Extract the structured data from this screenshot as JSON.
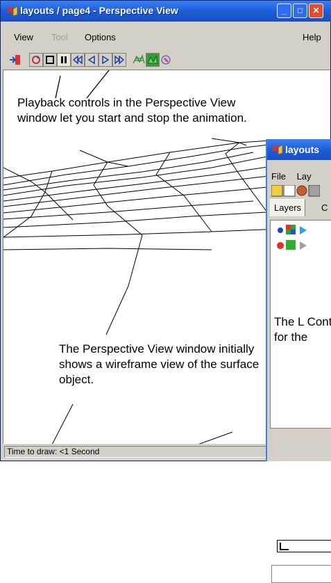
{
  "main_window": {
    "title": "layouts / page4 - Perspective View",
    "menu": {
      "view": "View",
      "tool": "Tool",
      "options": "Options",
      "help": "Help"
    },
    "status_text": "Time to draw: <1 Second"
  },
  "annotations": {
    "playback": "Playback controls in the Perspective View window let you start and stop the animation.",
    "wireframe": "The Perspective View window initially shows a wireframe view of the surface object.",
    "layer_control": "The L Contr for the"
  },
  "second_window": {
    "title": "layouts",
    "menu": {
      "file": "File",
      "layout": "Lay"
    },
    "tabs": [
      "Layers",
      "C"
    ]
  },
  "colors": {
    "titlebar": "#1b5bd6",
    "face": "#d4d0c8",
    "close": "#e04d2b"
  }
}
